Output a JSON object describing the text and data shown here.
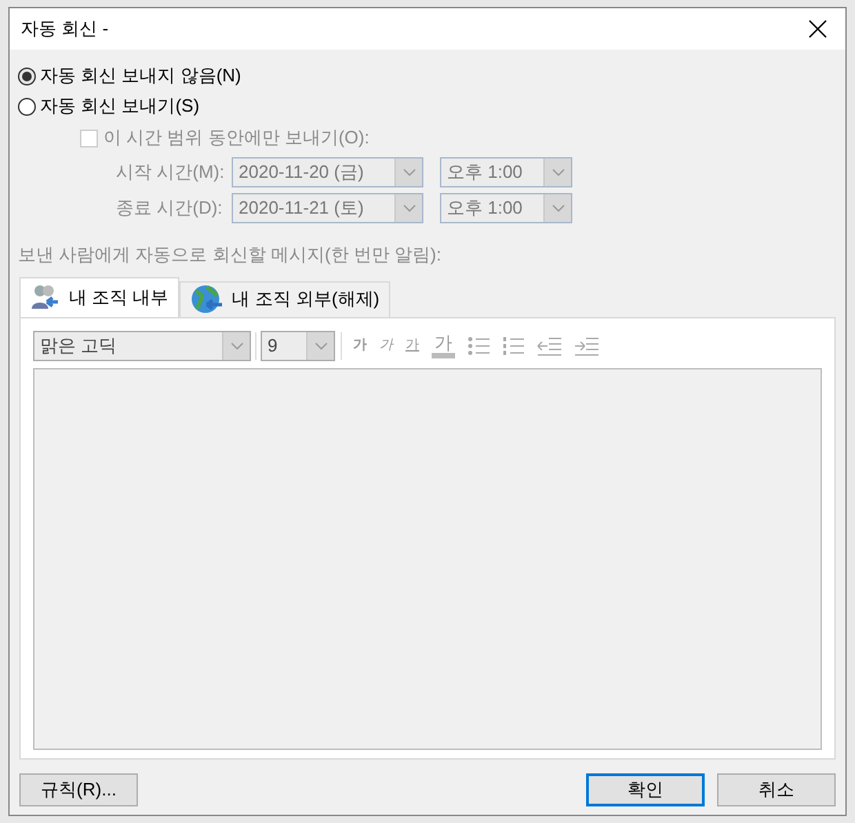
{
  "window": {
    "title": "자동 회신 -"
  },
  "reply_options": [
    {
      "label": "자동 회신 보내지 않음(N)",
      "selected": true
    },
    {
      "label": "자동 회신 보내기(S)",
      "selected": false
    }
  ],
  "time_range": {
    "label": "이 시간 범위 동안에만 보내기(O):",
    "checked": false,
    "disabled": true,
    "rows": [
      {
        "label": "시작 시간(M):",
        "date": "2020-11-20 (금)",
        "time": "오후 1:00"
      },
      {
        "label": "종료 시간(D):",
        "date": "2020-11-21 (토)",
        "time": "오후 1:00"
      }
    ]
  },
  "message_label": "보낸 사람에게 자동으로 회신할 메시지(한 번만 알림):",
  "tabs": [
    {
      "label": "내 조직 내부",
      "kind": "people",
      "selected": true
    },
    {
      "label": "내 조직 외부(해제)",
      "kind": "globe",
      "selected": false
    }
  ],
  "toolbar": {
    "font": "맑은 고딕",
    "size": "9",
    "buttons": [
      {
        "kind": "bold",
        "label": "가"
      },
      {
        "kind": "italic",
        "label": "가"
      },
      {
        "kind": "underline",
        "label": "가"
      },
      {
        "kind": "color",
        "label": "가"
      },
      {
        "kind": "bullets"
      },
      {
        "kind": "numbering"
      },
      {
        "kind": "outdent"
      },
      {
        "kind": "indent"
      }
    ]
  },
  "buttons": [
    {
      "label": "규칙(R)...",
      "default": false
    },
    {
      "label": "확인",
      "default": true
    },
    {
      "label": "취소",
      "default": false
    }
  ]
}
